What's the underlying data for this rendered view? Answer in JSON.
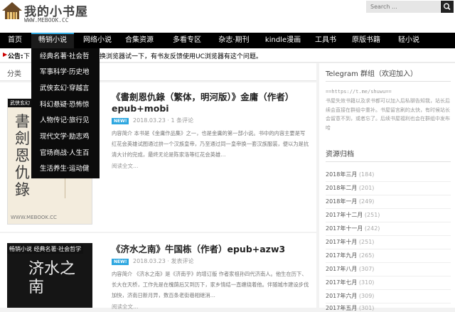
{
  "header": {
    "title": "我的小书屋",
    "url": "WWW.MEBOOK.CC",
    "search_placeholder": "Search ..."
  },
  "nav": {
    "items": [
      "首页",
      "畅销小说",
      "网络小说",
      "合集资源",
      "多看专区",
      "杂志·期刊",
      "kindle漫画",
      "工具书",
      "原版书籍",
      "轻小说"
    ]
  },
  "notice": {
    "label": "公告:",
    "text_left": "下",
    "text_right": "换浏览器试一下，有书友反馈使用UC浏览器有这个问题。"
  },
  "dropdown": {
    "items": [
      "经典名著·社会哲",
      "军事科学·历史地",
      "武侠玄幻·穿越言",
      "科幻悬疑·恐怖惊",
      "人物传记·旅行见",
      "现代文学·励志鸡",
      "官场商战·人生百",
      "生活养生·运动健"
    ]
  },
  "main": {
    "category": "分类"
  },
  "posts": [
    {
      "title": "《書劍恩仇錄（繁体，明河版）》金庸（作者）epub+mobi",
      "badge": "NEW!",
      "date": "2018.03.23",
      "sep": "·",
      "comments": "1 条评论",
      "excerpt": "内容简介 本书是《金庸作品集》之一，也是金庸的第一部小说。书中的内容主要是写红花会英雄试图通过拚一个汉族皇帝，乃至通过同一皇帝换一套汉族服装，便以为是抗清大计的完成，最终无论是陈家洛等红花会英雄…",
      "more": "阅读全文…",
      "cover_tag": "武侠玄幻",
      "cover_title": "書劍恩仇錄",
      "cover_url": "WWW.MEBOOK.CC"
    },
    {
      "title": "《济水之南》牛国栋（作者）epub+azw3",
      "badge": "NEW!",
      "date": "2018.03.23",
      "sep": "·",
      "comments": "发表评论",
      "excerpt": "内容简介 《济水之南》是《济南乎》的增订版 作者家祖孙四代济南人。他生在历下、长大在天桥，工作先是在槐荫后又到历下，家乡情结一直缠绕着他。伴随城市建设步伐加快，济南日新月异，数百条老街巷相继消…",
      "more": "阅读全文…",
      "cover_tag": "畅销小说  经典名著·社会哲学",
      "cover_big": "济水之南"
    }
  ],
  "sidebar": {
    "telegram_title": "Telegram 群组（欢迎加入）",
    "telegram_url": "==https://t.me/shuwu==",
    "telegram_text": "书屋失效书籍以及求书都可以加入后私聊告知我，站长后续会直接在群组中重补。书屋留言刷的太快，有时候站长会留意不到，或者忘了。后续书屋福利也会在群组中发布哈",
    "archive_title": "资源归档",
    "archives": [
      {
        "month": "2018年三月",
        "count": "(184)"
      },
      {
        "month": "2018年二月",
        "count": "(201)"
      },
      {
        "month": "2018年一月",
        "count": "(249)"
      },
      {
        "month": "2017年十二月",
        "count": "(251)"
      },
      {
        "month": "2017年十一月",
        "count": "(242)"
      },
      {
        "month": "2017年十月",
        "count": "(251)"
      },
      {
        "month": "2017年九月",
        "count": "(265)"
      },
      {
        "month": "2017年八月",
        "count": "(307)"
      },
      {
        "month": "2017年七月",
        "count": "(310)"
      },
      {
        "month": "2017年六月",
        "count": "(309)"
      },
      {
        "month": "2017年五月",
        "count": "(301)"
      }
    ]
  },
  "colors": {
    "accent": "#2ea7e0",
    "nav_bg": "#000000"
  }
}
